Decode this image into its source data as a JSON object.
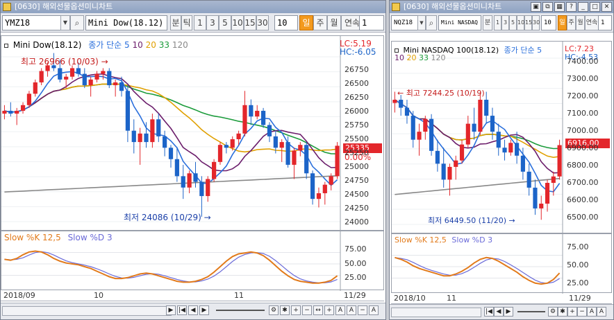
{
  "left": {
    "title": "[0630] 해외선물옵션미니차트",
    "symbol": "YMZ18",
    "name": "Mini Dow(18.12)",
    "btn_tick": "분",
    "btn_tick2": "틱",
    "periods": [
      "1",
      "3",
      "5",
      "10",
      "15",
      "30"
    ],
    "period_value": "10",
    "modes": [
      "일",
      "주",
      "월",
      "연속"
    ],
    "count": "1",
    "legend_name": "Mini Dow(18.12)",
    "legend_ma_label": "종가 단순",
    "ma_periods": [
      "5",
      "10",
      "20",
      "33",
      "120"
    ],
    "lc": "LC:5.19",
    "hc": "HC:-6.05",
    "high_note": "최고 26966 (10/03)",
    "low_note": "최저 24086 (10/29)",
    "price_box": "25335",
    "pct_label": "0.00%",
    "yticks": [
      "26750",
      "26500",
      "26250",
      "26000",
      "25750",
      "25500",
      "25250",
      "25000",
      "24750",
      "24500",
      "24250",
      "24000"
    ],
    "stoch_legend": [
      "Slow %K 12,5",
      "Slow %D 3"
    ],
    "stoch_ticks": [
      "75.00",
      "50.00",
      "25.00"
    ],
    "date_labels": [
      "2018/09",
      "10",
      "11",
      "11/29"
    ]
  },
  "right": {
    "title": "[0630] 해외선물옵션미니차트",
    "symbol": "NQZ18",
    "btn_tick": "분",
    "periods": [
      "1",
      "3",
      "5",
      "10",
      "15",
      "30"
    ],
    "period_value": "10",
    "modes": [
      "일",
      "주",
      "월",
      "연속"
    ],
    "count": "1",
    "legend_name": "Mini NASDAQ 100(18.12)",
    "legend_ma_label": "종가 단순 5",
    "ma_periods": [
      "10",
      "20",
      "33",
      "120"
    ],
    "lc": "LC:7.23",
    "hc": "HC:-4.53",
    "high_note": "최고 7244.25 (10/19)",
    "low_note": "최저 6449.50 (11/20)",
    "price_box": "6916.00",
    "yticks": [
      "7400.00",
      "7300.00",
      "7200.00",
      "7100.00",
      "7000.00",
      "6900.00",
      "6800.00",
      "6700.00",
      "6600.00",
      "6500.00"
    ],
    "stoch_legend": [
      "Slow %K 12,5",
      "Slow %D 3"
    ],
    "stoch_ticks": [
      "75.00",
      "50.00",
      "25.00"
    ],
    "date_labels": [
      "2018/10",
      "11",
      "11/29"
    ]
  },
  "colors": {
    "up": "#e3262b",
    "down": "#1c64c8",
    "ma5": "#2a6fdc",
    "ma10": "#6b1d6b",
    "ma20": "#e0a000",
    "ma33": "#1a9b3a",
    "ma120": "#888888",
    "k": "#e27a1a",
    "d": "#6a6ad8"
  },
  "chart_data": [
    {
      "type": "candlestick",
      "title": "Mini Dow(18.12)",
      "ylim": [
        24000,
        26900
      ],
      "candles": [
        [
          25900,
          26050,
          25800,
          25950
        ],
        [
          25950,
          26100,
          25850,
          25900
        ],
        [
          25900,
          26000,
          25700,
          25950
        ],
        [
          25950,
          26100,
          25900,
          26050
        ],
        [
          26050,
          26300,
          26000,
          26250
        ],
        [
          26250,
          26500,
          26200,
          26450
        ],
        [
          26450,
          26700,
          26400,
          26650
        ],
        [
          26650,
          26800,
          26550,
          26750
        ],
        [
          26750,
          26966,
          26650,
          26700
        ],
        [
          26700,
          26850,
          26450,
          26500
        ],
        [
          26500,
          26600,
          26350,
          26550
        ],
        [
          26550,
          26750,
          26500,
          26700
        ],
        [
          26700,
          26800,
          26550,
          26600
        ],
        [
          26600,
          26700,
          26350,
          26400
        ],
        [
          26400,
          26550,
          26200,
          26500
        ],
        [
          26500,
          26650,
          26450,
          26600
        ],
        [
          26600,
          26700,
          26500,
          26650
        ],
        [
          26650,
          26700,
          26350,
          26400
        ],
        [
          26400,
          26500,
          26200,
          26450
        ],
        [
          26450,
          26550,
          26200,
          26300
        ],
        [
          26300,
          26400,
          25400,
          25600
        ],
        [
          25600,
          25800,
          25200,
          25400
        ],
        [
          25400,
          25650,
          25000,
          25550
        ],
        [
          25550,
          25750,
          25300,
          25400
        ],
        [
          25400,
          25900,
          25300,
          25800
        ],
        [
          25800,
          25900,
          25400,
          25500
        ],
        [
          25500,
          25600,
          25150,
          25300
        ],
        [
          25300,
          25350,
          24950,
          25100
        ],
        [
          25100,
          25300,
          24700,
          24800
        ],
        [
          24800,
          25000,
          24400,
          24600
        ],
        [
          24600,
          24900,
          24500,
          24850
        ],
        [
          24850,
          25050,
          24600,
          24700
        ],
        [
          24700,
          24800,
          24086,
          24450
        ],
        [
          24450,
          24800,
          24350,
          24750
        ],
        [
          24750,
          25100,
          24700,
          25050
        ],
        [
          25050,
          25400,
          25000,
          25350
        ],
        [
          25350,
          25400,
          25200,
          25300
        ],
        [
          25300,
          25500,
          25250,
          25450
        ],
        [
          25450,
          25600,
          25350,
          25550
        ],
        [
          25550,
          26300,
          25500,
          26050
        ],
        [
          26050,
          26150,
          25700,
          25850
        ],
        [
          25850,
          26050,
          25800,
          25950
        ],
        [
          25950,
          26000,
          25650,
          25700
        ],
        [
          25700,
          25750,
          25400,
          25500
        ],
        [
          25500,
          25600,
          25200,
          25300
        ],
        [
          25300,
          25450,
          25050,
          25400
        ],
        [
          25400,
          25500,
          24950,
          25000
        ],
        [
          25000,
          25300,
          24750,
          25250
        ],
        [
          25250,
          25400,
          25150,
          25350
        ],
        [
          25350,
          25400,
          24750,
          24850
        ],
        [
          24850,
          24900,
          24300,
          24400
        ],
        [
          24400,
          24600,
          24250,
          24500
        ],
        [
          24500,
          24700,
          24300,
          24650
        ],
        [
          24650,
          24850,
          24550,
          24800
        ],
        [
          24800,
          25400,
          24750,
          25335
        ]
      ],
      "stoch": [
        60,
        58,
        62,
        70,
        76,
        78,
        76,
        70,
        62,
        56,
        52,
        50,
        48,
        44,
        40,
        34,
        28,
        22,
        18,
        18,
        20,
        24,
        28,
        30,
        28,
        24,
        20,
        16,
        12,
        10,
        10,
        12,
        16,
        22,
        32,
        44,
        56,
        66,
        72,
        74,
        76,
        74,
        68,
        58,
        46,
        34,
        24,
        16,
        12,
        10,
        8,
        8,
        10,
        14,
        24
      ],
      "xlabels": [
        "2018/09",
        "10",
        "11",
        "11/29"
      ]
    },
    {
      "type": "candlestick",
      "title": "Mini NASDAQ 100(18.12)",
      "ylim": [
        6420,
        7460
      ],
      "candles": [
        [
          7180,
          7250,
          7120,
          7200
        ],
        [
          7200,
          7230,
          7100,
          7150
        ],
        [
          7150,
          7200,
          7050,
          7100
        ],
        [
          7100,
          7130,
          6900,
          6950
        ],
        [
          6950,
          7050,
          6850,
          7000
        ],
        [
          7000,
          7100,
          6950,
          7080
        ],
        [
          7080,
          7110,
          6850,
          6880
        ],
        [
          6880,
          6950,
          6750,
          6800
        ],
        [
          6800,
          6900,
          6650,
          6700
        ],
        [
          6700,
          6800,
          6600,
          6780
        ],
        [
          6780,
          6850,
          6700,
          6820
        ],
        [
          6820,
          6950,
          6800,
          6920
        ],
        [
          6920,
          7100,
          6900,
          7050
        ],
        [
          7050,
          7150,
          6950,
          7000
        ],
        [
          7000,
          7244,
          6980,
          7200
        ],
        [
          7200,
          7250,
          7050,
          7100
        ],
        [
          7100,
          7150,
          6950,
          7000
        ],
        [
          7000,
          7050,
          6850,
          6900
        ],
        [
          6900,
          6950,
          6820,
          6870
        ],
        [
          6870,
          6950,
          6850,
          6930
        ],
        [
          6930,
          7000,
          6800,
          6850
        ],
        [
          6850,
          6900,
          6700,
          6750
        ],
        [
          6750,
          6800,
          6600,
          6650
        ],
        [
          6650,
          6700,
          6480,
          6520
        ],
        [
          6520,
          6600,
          6449,
          6550
        ],
        [
          6550,
          6700,
          6500,
          6680
        ],
        [
          6680,
          6750,
          6600,
          6720
        ],
        [
          6720,
          6950,
          6700,
          6916
        ]
      ],
      "stoch": [
        70,
        66,
        60,
        52,
        46,
        42,
        38,
        34,
        30,
        30,
        34,
        40,
        48,
        58,
        66,
        70,
        68,
        62,
        54,
        46,
        38,
        28,
        20,
        14,
        12,
        14,
        22,
        36
      ],
      "xlabels": [
        "2018/10",
        "11",
        "11/29"
      ]
    }
  ]
}
